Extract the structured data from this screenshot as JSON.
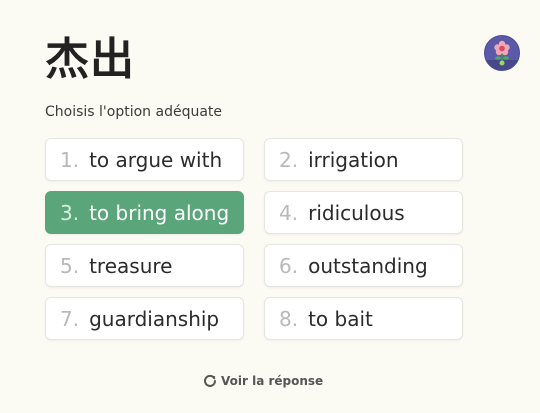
{
  "header": {
    "title": "杰出",
    "instruction": "Choisis l'option adéquate"
  },
  "options": [
    {
      "number": "1.",
      "label": "to argue with",
      "selected": false
    },
    {
      "number": "2.",
      "label": "irrigation",
      "selected": false
    },
    {
      "number": "3.",
      "label": "to bring along",
      "selected": true
    },
    {
      "number": "4.",
      "label": "ridiculous",
      "selected": false
    },
    {
      "number": "5.",
      "label": "treasure",
      "selected": false
    },
    {
      "number": "6.",
      "label": "outstanding",
      "selected": false
    },
    {
      "number": "7.",
      "label": "guardianship",
      "selected": false
    },
    {
      "number": "8.",
      "label": "to bait",
      "selected": false
    }
  ],
  "footer": {
    "reveal_label": "Voir la réponse",
    "reveal_icon": "refresh-icon"
  },
  "avatar": {
    "icon": "flower-icon"
  },
  "colors": {
    "background": "#fbfaf3",
    "selected": "#5aa57a",
    "avatar": "#5a5aa8"
  }
}
